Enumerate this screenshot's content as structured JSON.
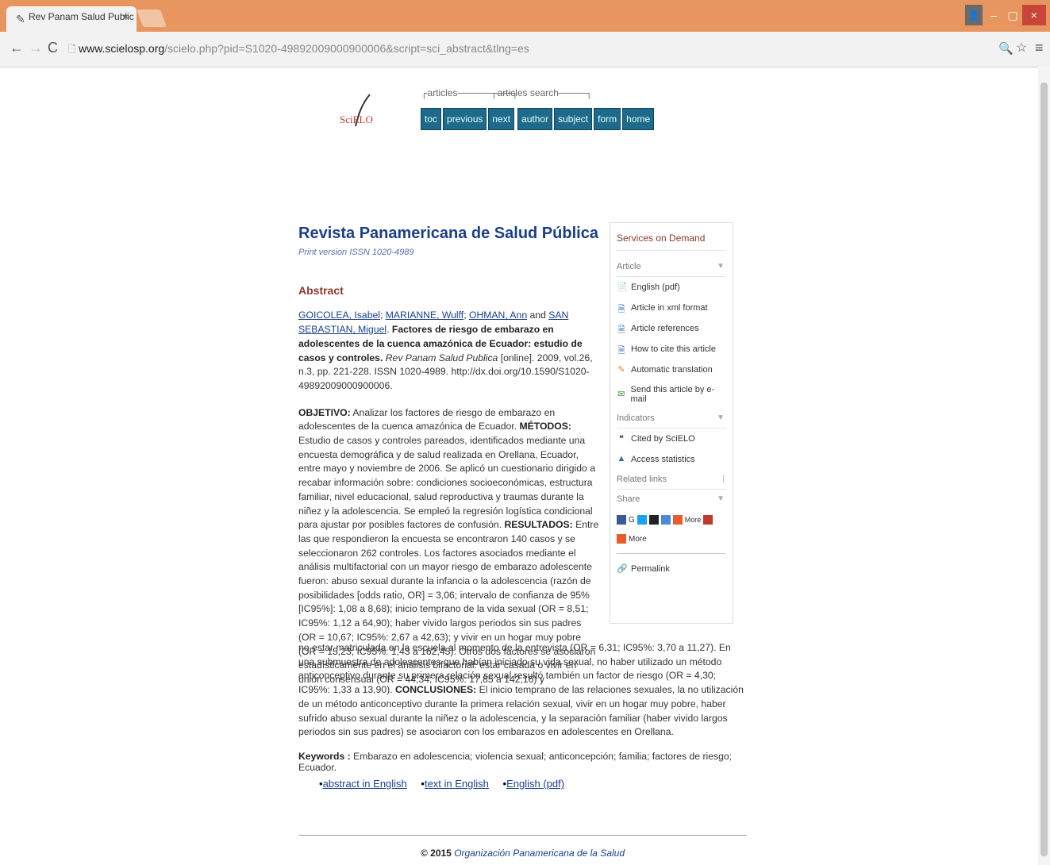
{
  "browser": {
    "tab_title": "Rev Panam Salud Public",
    "tab_close": "×",
    "url_host": "www.scielosp.org",
    "url_path": "/scielo.php?pid=S1020-49892009000900006&script=sci_abstract&tlng=es",
    "win_min": "–",
    "win_max": "▢",
    "win_close": "×"
  },
  "nav": {
    "articles_label": "articles",
    "search_label": "articles search",
    "buttons": [
      "toc",
      "previous",
      "next",
      "author",
      "subject",
      "form",
      "home"
    ]
  },
  "logo_text": "SciELO",
  "article": {
    "journal": "Revista Panamericana de Salud Pública",
    "issn": "Print version ISSN 1020-4989",
    "abstract_heading": "Abstract",
    "authors": [
      "GOICOLEA, Isabel",
      "MARIANNE, Wulff",
      "OHMAN, Ann",
      "SAN SEBASTIAN, Miguel"
    ],
    "and": "and",
    "title": "Factores de riesgo de embarazo en adolescentes de la cuenca amazónica de Ecuador: estudio de casos y controles.",
    "citation_journal": "Rev Panam Salud Publica",
    "citation_rest": "[online]. 2009, vol.26, n.3, pp. 221-228. ISSN 1020-4989.",
    "doi": "http://dx.doi.org/10.1590/S1020-49892009000900006.",
    "objetivo_label": "OBJETIVO:",
    "objetivo": "Analizar los factores de riesgo de embarazo en adolescentes de la cuenca amazónica de Ecuador.",
    "metodos_label": "MÉTODOS:",
    "metodos": "Estudio de casos y controles pareados, identificados mediante una encuesta demográfica y de salud realizada en Orellana, Ecuador, entre mayo y noviembre de 2006. Se aplicó un cuestionario dirigido a recabar información sobre: condiciones socioeconómicas, estructura familiar, nivel educacional, salud reproductiva y traumas durante la niñez y la adolescencia. Se empleó la regresión logística condicional para ajustar por posibles factores de confusión.",
    "resultados_label": "RESULTADOS:",
    "resultados": "Entre las que respondieron la encuesta se encontraron 140 casos y se seleccionaron 262 controles. Los factores asociados mediante el análisis multifactorial con un mayor riesgo de embarazo adolescente fueron: abuso sexual durante la infancia o la adolescencia (razón de posibilidades [odds ratio, OR] = 3,06; intervalo de confianza de 95% [IC95%]: 1,08 a 8,68); inicio temprano de la vida sexual (OR = 8,51; IC95%: 1,12 a 64,90); haber vivido largos periodos sin sus padres (OR = 10,67; IC95%: 2,67 a 42,63); y vivir en un hogar muy pobre (OR = 15,23; IC95%: 1,43 a 162,45). Otros dos factores se asociaron estadísticamente en el análisis bifactorial: estar casada o vivir en unión consensual (OR = 44,34; IC95%: 17,85 a 142,16) y",
    "resultados_cont": "no estar matriculada en la escuela al momento de la entrevista (OR = 6,31; IC95%: 3,70 a 11,27). En una submuestra de adolescentes que habían iniciado su vida sexual, no haber utilizado un método anticonceptivo durante su primera relación sexual resultó también un factor de riesgo (OR = 4,30; IC95%: 1,33 a 13,90).",
    "conclusiones_label": "CONCLUSIONES:",
    "conclusiones": "El inicio temprano de las relaciones sexuales, la no utilización de un método anticonceptivo durante la primera relación sexual, vivir en un hogar muy pobre, haber sufrido abuso sexual durante la niñez o la adolescencia, y la separación familiar (haber vivido largos periodos sin sus padres) se asociaron con los embarazos en adolescentes en Orellana.",
    "keywords_label": "Keywords :",
    "keywords": "Embarazo en adolescencia; violencia sexual; anticoncepción; familia; factores de riesgo; Ecuador.",
    "links": [
      "abstract in English",
      "text in English",
      "English (pdf)"
    ],
    "footer_year": "© 2015",
    "footer_org": "Organización Panamericana de la Salud"
  },
  "panel": {
    "heading": "Services on Demand",
    "article_section": "Article",
    "article_items": [
      "English (pdf)",
      "Article in xml format",
      "Article references",
      "How to cite this article",
      "Automatic translation",
      "Send this article by e-mail"
    ],
    "indicators_section": "Indicators",
    "indicator_items": [
      "Cited by SciELO",
      "Access statistics"
    ],
    "related_section": "Related links",
    "share_section": "Share",
    "more1": "More",
    "more2": "More",
    "permalink": "Permalink"
  }
}
